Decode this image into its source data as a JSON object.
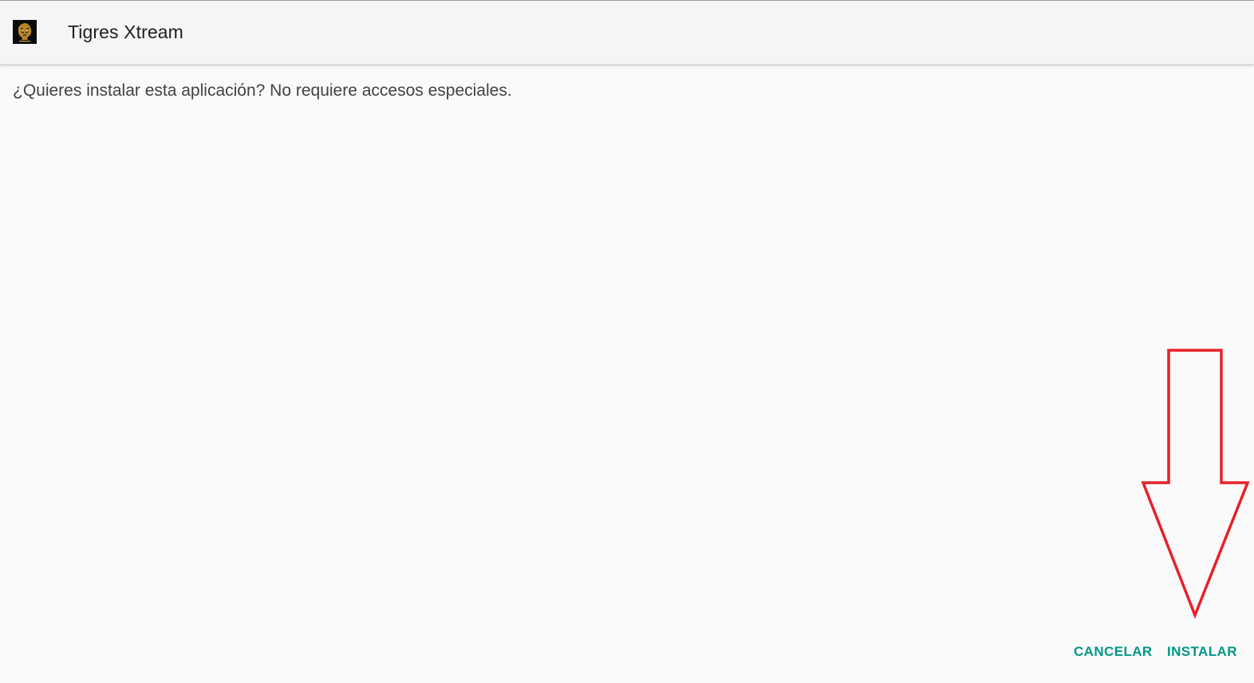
{
  "app": {
    "title": "Tigres Xtream",
    "icon": "tiger-logo-icon"
  },
  "dialog": {
    "message": "¿Quieres instalar esta aplicación? No requiere accesos especiales."
  },
  "actions": {
    "cancel_label": "CANCELAR",
    "install_label": "INSTALAR"
  },
  "annotation": {
    "icon": "red-arrow-down-icon",
    "color": "#e8202a"
  },
  "colors": {
    "accent": "#009688",
    "background": "#fafafa",
    "app_bar": "#f5f5f5",
    "title_text": "#212121",
    "body_text": "#424242"
  }
}
